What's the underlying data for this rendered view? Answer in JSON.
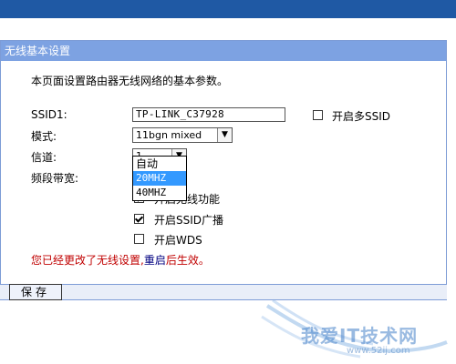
{
  "page": {
    "title": "无线基本设置",
    "intro": "本页面设置路由器无线网络的基本参数。"
  },
  "form": {
    "ssid_label": "SSID1:",
    "ssid_value": "TP-LINK_C37928",
    "multi_ssid_label": "开启多SSID",
    "multi_ssid_checked": false,
    "mode_label": "模式:",
    "mode_value": "11bgn mixed",
    "channel_label": "信道:",
    "channel_value": "1",
    "bandwidth_label": "频段带宽:",
    "bandwidth_options": [
      "自动",
      "20MHZ",
      "40MHZ"
    ],
    "bandwidth_selected": "20MHZ",
    "enable_wireless_label": "开启无线功能",
    "enable_wireless_checked": true,
    "ssid_broadcast_label": "开启SSID广播",
    "ssid_broadcast_checked": true,
    "wds_label": "开启WDS",
    "wds_checked": false
  },
  "notice": {
    "prefix": "您已经更改了无线设置,",
    "link": "重启",
    "suffix": "后生效。"
  },
  "actions": {
    "save_label": "保存"
  },
  "watermark": {
    "text": "我爱IT技术网",
    "url": "www.52ij.com"
  },
  "colors": {
    "title_bar": "#7da2e2",
    "top_bar": "#1f59a4",
    "warning": "#c00000",
    "selected_option": "#3399ff"
  }
}
